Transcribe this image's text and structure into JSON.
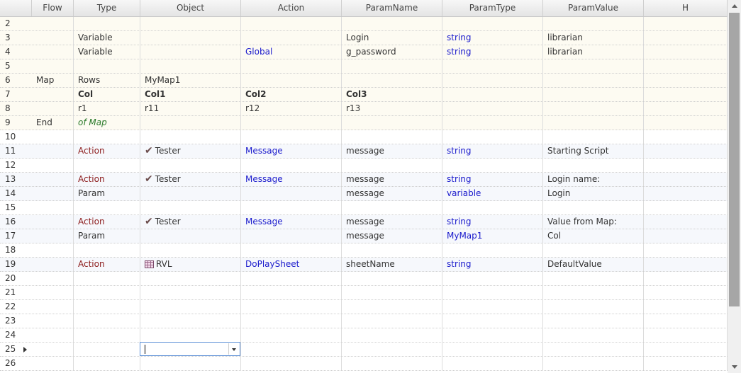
{
  "columns": [
    "Flow",
    "Type",
    "Object",
    "Action",
    "ParamName",
    "ParamType",
    "ParamValue",
    "H"
  ],
  "rows": [
    {
      "n": "2",
      "bg": "yellow",
      "cells": [
        "",
        "",
        "",
        "",
        "",
        "",
        "",
        ""
      ]
    },
    {
      "n": "3",
      "bg": "yellow",
      "cells": [
        "",
        "Variable",
        "",
        "",
        "Login",
        "string",
        "librarian",
        ""
      ],
      "style": {
        "5": "blue"
      }
    },
    {
      "n": "4",
      "bg": "yellow",
      "cells": [
        "",
        "Variable",
        "",
        "Global",
        "g_password",
        "string",
        "librarian",
        ""
      ],
      "style": {
        "3": "blue",
        "5": "blue"
      }
    },
    {
      "n": "5",
      "bg": "yellow",
      "cells": [
        "",
        "",
        "",
        "",
        "",
        "",
        "",
        ""
      ]
    },
    {
      "n": "6",
      "bg": "yellow",
      "cells": [
        "Map",
        "Rows",
        "MyMap1",
        "",
        "",
        "",
        "",
        ""
      ]
    },
    {
      "n": "7",
      "bg": "yellow",
      "cells": [
        "",
        "Col",
        "Col1",
        "Col2",
        "Col3",
        "",
        "",
        ""
      ],
      "style": {
        "1": "bold",
        "2": "bold",
        "3": "bold",
        "4": "bold"
      }
    },
    {
      "n": "8",
      "bg": "yellow",
      "cells": [
        "",
        "r1",
        "r11",
        "r12",
        "r13",
        "",
        "",
        ""
      ]
    },
    {
      "n": "9",
      "bg": "yellow",
      "cells": [
        "End",
        "of Map",
        "",
        "",
        "",
        "",
        "",
        ""
      ],
      "style": {
        "1": "green"
      }
    },
    {
      "n": "10",
      "bg": "white",
      "cells": [
        "",
        "",
        "",
        "",
        "",
        "",
        "",
        ""
      ]
    },
    {
      "n": "11",
      "bg": "blue",
      "cells": [
        "",
        "Action",
        "Tester",
        "Message",
        "message",
        "string",
        "Starting Script",
        ""
      ],
      "style": {
        "1": "red",
        "3": "blue",
        "5": "blue"
      },
      "icon": "check"
    },
    {
      "n": "12",
      "bg": "white",
      "cells": [
        "",
        "",
        "",
        "",
        "",
        "",
        "",
        ""
      ]
    },
    {
      "n": "13",
      "bg": "blue",
      "cells": [
        "",
        "Action",
        "Tester",
        "Message",
        "message",
        "string",
        "Login name:",
        ""
      ],
      "style": {
        "1": "red",
        "3": "blue",
        "5": "blue"
      },
      "icon": "check"
    },
    {
      "n": "14",
      "bg": "blue",
      "cells": [
        "",
        "Param",
        "",
        "",
        "message",
        "variable",
        "Login",
        ""
      ],
      "style": {
        "5": "blue"
      }
    },
    {
      "n": "15",
      "bg": "white",
      "cells": [
        "",
        "",
        "",
        "",
        "",
        "",
        "",
        ""
      ]
    },
    {
      "n": "16",
      "bg": "blue",
      "cells": [
        "",
        "Action",
        "Tester",
        "Message",
        "message",
        "string",
        "Value from Map:",
        ""
      ],
      "style": {
        "1": "red",
        "3": "blue",
        "5": "blue"
      },
      "icon": "check"
    },
    {
      "n": "17",
      "bg": "blue",
      "cells": [
        "",
        "Param",
        "",
        "",
        "message",
        "MyMap1",
        "Col",
        ""
      ],
      "style": {
        "5": "blue"
      }
    },
    {
      "n": "18",
      "bg": "white",
      "cells": [
        "",
        "",
        "",
        "",
        "",
        "",
        "",
        ""
      ]
    },
    {
      "n": "19",
      "bg": "blue",
      "cells": [
        "",
        "Action",
        "RVL",
        "DoPlaySheet",
        "sheetName",
        "string",
        "DefaultValue",
        ""
      ],
      "style": {
        "1": "red",
        "3": "blue",
        "5": "blue"
      },
      "icon": "table"
    },
    {
      "n": "20",
      "bg": "white",
      "cells": [
        "",
        "",
        "",
        "",
        "",
        "",
        "",
        ""
      ]
    },
    {
      "n": "21",
      "bg": "white",
      "cells": [
        "",
        "",
        "",
        "",
        "",
        "",
        "",
        ""
      ]
    },
    {
      "n": "22",
      "bg": "white",
      "cells": [
        "",
        "",
        "",
        "",
        "",
        "",
        "",
        ""
      ]
    },
    {
      "n": "23",
      "bg": "white",
      "cells": [
        "",
        "",
        "",
        "",
        "",
        "",
        "",
        ""
      ]
    },
    {
      "n": "24",
      "bg": "white",
      "cells": [
        "",
        "",
        "",
        "",
        "",
        "",
        "",
        ""
      ]
    },
    {
      "n": "25",
      "bg": "white",
      "cells": [
        "",
        "",
        "",
        "",
        "",
        "",
        "",
        ""
      ],
      "current": true
    },
    {
      "n": "26",
      "bg": "white",
      "cells": [
        "",
        "",
        "",
        "",
        "",
        "",
        "",
        ""
      ]
    }
  ],
  "editor": {
    "value": ""
  },
  "icons": {
    "check": "checkmark-icon",
    "table": "table-icon",
    "current_row": "row-pointer-icon"
  }
}
